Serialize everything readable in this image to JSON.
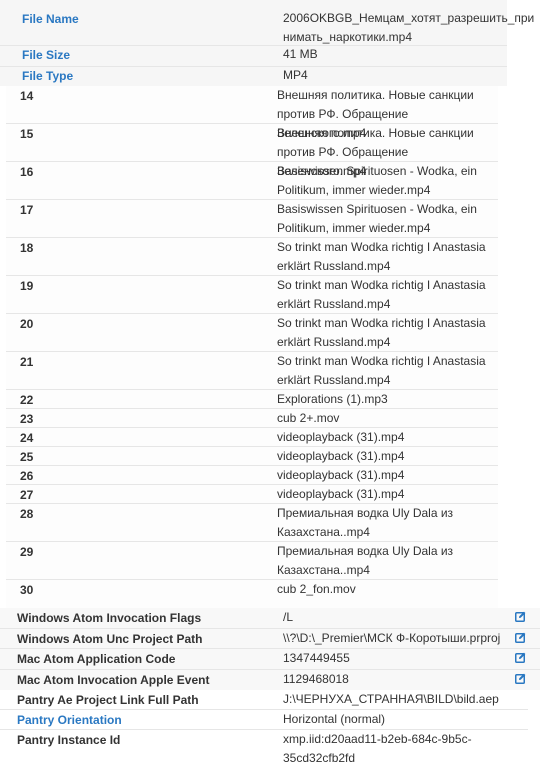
{
  "file_info": [
    {
      "label": "File Name",
      "value": "2006OKBGB_Немцам_хотят_разрешить_при нимать_наркотики.mp4"
    },
    {
      "label": "File Size",
      "value": "41 MB"
    },
    {
      "label": "File Type",
      "value": "MP4"
    }
  ],
  "tracks": [
    {
      "label": "14",
      "value": "Внешняя политика. Новые санкции против РФ. Обращение Зеленского.mp4"
    },
    {
      "label": "15",
      "value": "Внешняя политика. Новые санкции против РФ. Обращение Зеленского.mp4"
    },
    {
      "label": "16",
      "value": "Basiswissen Spirituosen - Wodka, ein Politikum, immer wieder.mp4"
    },
    {
      "label": "17",
      "value": "Basiswissen Spirituosen - Wodka, ein Politikum, immer wieder.mp4"
    },
    {
      "label": "18",
      "value": "So trinkt man Wodka richtig I Anastasia erklärt Russland.mp4"
    },
    {
      "label": "19",
      "value": "So trinkt man Wodka richtig I Anastasia erklärt Russland.mp4"
    },
    {
      "label": "20",
      "value": "So trinkt man Wodka richtig I Anastasia erklärt Russland.mp4"
    },
    {
      "label": "21",
      "value": "So trinkt man Wodka richtig I Anastasia erklärt Russland.mp4"
    },
    {
      "label": "22",
      "value": "Explorations (1).mp3"
    },
    {
      "label": "23",
      "value": "cub 2+.mov"
    },
    {
      "label": "24",
      "value": "videoplayback (31).mp4"
    },
    {
      "label": "25",
      "value": "videoplayback (31).mp4"
    },
    {
      "label": "26",
      "value": "videoplayback (31).mp4"
    },
    {
      "label": "27",
      "value": "videoplayback (31).mp4"
    },
    {
      "label": "28",
      "value": "Премиальная водка Uly Dala из Казахстана..mp4"
    },
    {
      "label": "29",
      "value": "Премиальная водка Uly Dala из Казахстана..mp4"
    },
    {
      "label": "30",
      "value": "cub 2_fon.mov"
    }
  ],
  "atom": [
    {
      "label": "Windows Atom Invocation Flags",
      "value": "/L",
      "icon": "edit-icon"
    },
    {
      "label": "Windows Atom Unc Project Path",
      "value": "\\\\?\\D:\\_Premier\\МСК Ф-Коротыши.prproj",
      "icon": "edit-icon"
    },
    {
      "label": "Mac Atom Application Code",
      "value": "1347449455",
      "icon": "edit-icon"
    },
    {
      "label": "Mac Atom Invocation Apple Event",
      "value": "1129468018",
      "icon": "edit-icon"
    }
  ],
  "pantry": [
    {
      "label": "Pantry Ae Project Link Full Path",
      "value": "J:\\ЧЕРНУХА_СТРАННАЯ\\BILD\\bild.aep"
    },
    {
      "label": "Pantry Orientation",
      "value": "Horizontal (normal)"
    },
    {
      "label": "Pantry Instance Id",
      "value": "xmp.iid:d20aad11-b2eb-684c-9b5c-35cd32cfb2fd"
    }
  ],
  "colors": {
    "link": "#2a78c2",
    "text": "#333333"
  }
}
